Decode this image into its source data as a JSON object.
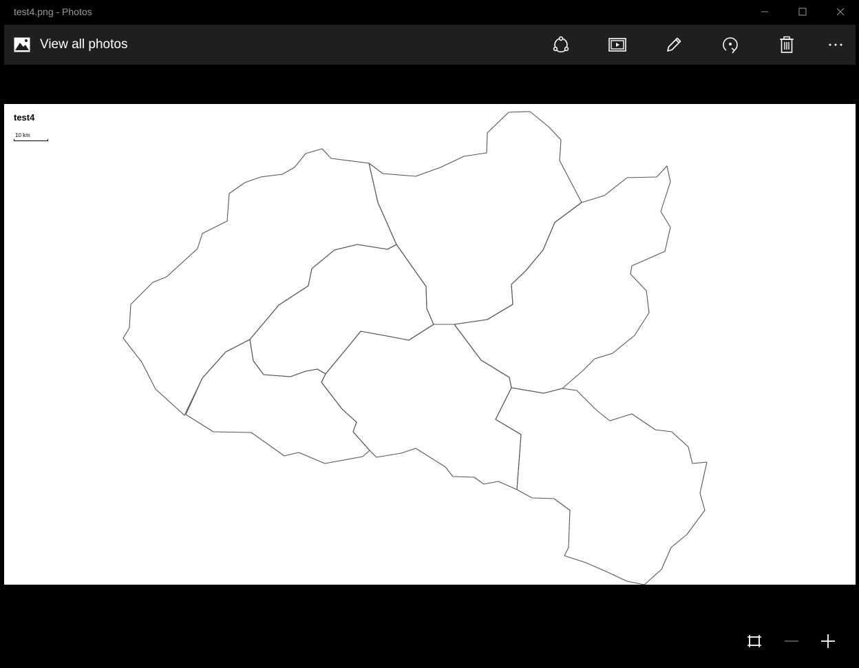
{
  "window": {
    "title": "test4.png - Photos",
    "controls": [
      "minimize",
      "maximize",
      "close"
    ]
  },
  "toolbar": {
    "back_label": "View all photos",
    "back_icon": "photo-icon",
    "actions": [
      {
        "name": "share",
        "icon": "share-icon"
      },
      {
        "name": "slideshow",
        "icon": "slideshow-icon"
      },
      {
        "name": "edit",
        "icon": "pencil-icon"
      },
      {
        "name": "rotate",
        "icon": "rotate-icon"
      },
      {
        "name": "delete",
        "icon": "trash-icon"
      },
      {
        "name": "more",
        "icon": "more-icon"
      }
    ]
  },
  "image": {
    "title": "test4",
    "scale_label": "10 km"
  },
  "zoom_controls": [
    {
      "name": "fit",
      "icon": "fit-to-window-icon"
    },
    {
      "name": "zoom-out",
      "icon": "minus-icon"
    },
    {
      "name": "zoom-in",
      "icon": "plus-icon"
    }
  ],
  "colors": {
    "chrome_background": "#000000",
    "toolbar_background": "#1f1f1f",
    "title_text": "#9a9a9a",
    "icon": "#ffffff",
    "image_background": "#ffffff",
    "map_stroke": "#555555"
  }
}
